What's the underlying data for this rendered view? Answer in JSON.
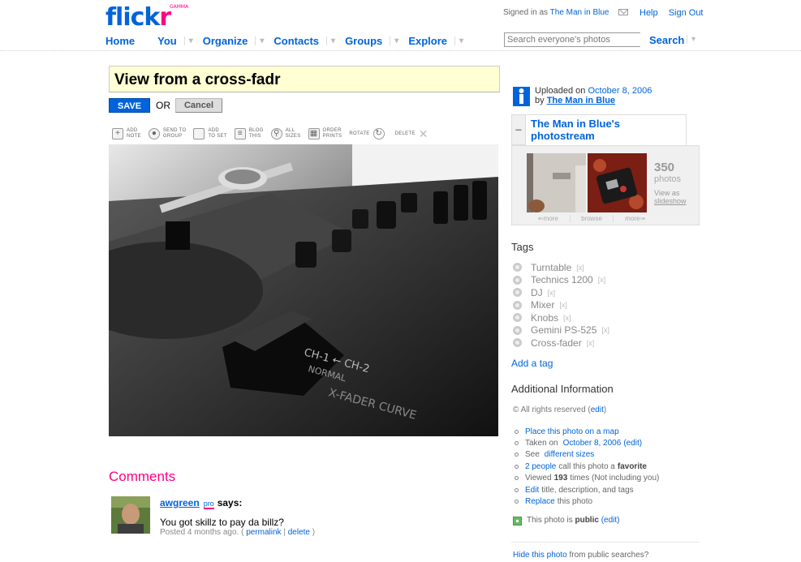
{
  "header": {
    "logo_main": "flick",
    "logo_r": "r",
    "logo_badge": "GAMMA",
    "signed_in_prefix": "Signed in as",
    "signed_in_user": "The Man in Blue",
    "help": "Help",
    "sign_out": "Sign Out"
  },
  "nav": {
    "items": [
      "Home",
      "You",
      "Organize",
      "Contacts",
      "Groups",
      "Explore"
    ],
    "dropdown_glyph": "▾",
    "search_placeholder": "Search everyone's photos",
    "search_button": "Search"
  },
  "editor": {
    "title_value": "View from a cross-fadr",
    "save": "SAVE",
    "or": "OR",
    "cancel": "Cancel"
  },
  "toolbar": {
    "add_note": "ADD\nNOTE",
    "send_to_group": "SEND TO\nGROUP",
    "add_to_set": "ADD\nTO SET",
    "blog_this": "BLOG\nTHIS",
    "all_sizes": "ALL\nSIZES",
    "order_prints": "ORDER\nPRINTS",
    "rotate": "ROTATE",
    "delete": "DELETE"
  },
  "comments": {
    "heading": "Comments",
    "user": "awgreen",
    "pro": "pro",
    "says": "says:",
    "text": "You got skillz to pay da billz?",
    "posted": "Posted 4 months ago. (",
    "permalink": "permalink",
    "sep": "|",
    "delete": "delete",
    "close": ")"
  },
  "sidebar": {
    "uploaded_on": "Uploaded on",
    "upload_date": "October 8, 2006",
    "by": "by",
    "by_user": "The Man in Blue",
    "photostream_title": "The Man in Blue's photostream",
    "collapse": "−",
    "photo_count": "350",
    "photos_label": "photos",
    "view_as": "View as",
    "slideshow": "slideshow",
    "nav_more_prev": "⇐more",
    "nav_browse": "browse",
    "nav_more_next": "more⇒",
    "tags_heading": "Tags",
    "tags": [
      {
        "name": "Turntable",
        "remove": "[x]"
      },
      {
        "name": "Technics 1200",
        "remove": "[x]"
      },
      {
        "name": "DJ",
        "remove": "[x]"
      },
      {
        "name": "Mixer",
        "remove": "[x]"
      },
      {
        "name": "Knobs",
        "remove": "[x]"
      },
      {
        "name": "Gemini PS-525",
        "remove": "[x]"
      },
      {
        "name": "Cross-fader",
        "remove": "[x]"
      }
    ],
    "add_tag": "Add a tag",
    "additional_heading": "Additional Information",
    "rights_text": "© All rights reserved (",
    "rights_edit": "edit",
    "rights_close": ")",
    "info": {
      "map": "Place this photo on a map",
      "taken_prefix": "Taken on",
      "taken_date": "October 8, 2006",
      "taken_edit": "(edit)",
      "see": "See",
      "sizes": "different sizes",
      "people": "2 people",
      "call": "call this photo a",
      "favorite": "favorite",
      "viewed_prefix": "Viewed",
      "viewed_count": "193",
      "viewed_suffix": "times (Not including you)",
      "edit": "Edit",
      "edit_suffix": "title, description, and tags",
      "replace": "Replace",
      "replace_suffix": "this photo"
    },
    "public_prefix": "This photo is",
    "public_word": "public",
    "public_edit": "(edit)",
    "hide_link": "Hide this photo",
    "hide_suffix": "from public searches?"
  }
}
